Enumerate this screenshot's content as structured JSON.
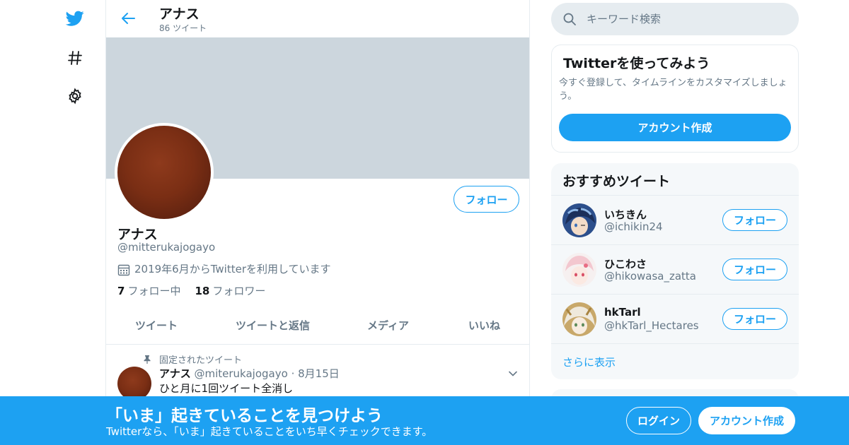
{
  "colors": {
    "accent": "#1da1f2",
    "banner": "#ccd6dd",
    "muted": "#657786",
    "text": "#14171a"
  },
  "nav": {
    "icons": [
      "twitter-bird-icon",
      "hashtag-icon",
      "gear-icon"
    ]
  },
  "header": {
    "title": "アナス",
    "tweet_count": "86 ツイート"
  },
  "profile": {
    "follow_label": "フォロー",
    "name": "アナス",
    "handle": "@mitterukajogayo",
    "joined": "2019年6月からTwitterを利用しています",
    "following_count": "7",
    "following_label": "フォロー中",
    "followers_count": "18",
    "followers_label": "フォロワー"
  },
  "tabs": [
    "ツイート",
    "ツイートと返信",
    "メディア",
    "いいね"
  ],
  "pinned_tweet": {
    "pinned_label": "固定されたツイート",
    "author": "アナス",
    "handle": "@miterukajogayo",
    "date": "8月15日",
    "text": "ひと月に1回ツイート全消し"
  },
  "search": {
    "placeholder": "キーワード検索"
  },
  "signup_card": {
    "title": "Twitterを使ってみよう",
    "description": "今すぐ登録して、タイムラインをカスタマイズしましょう。",
    "button": "アカウント作成"
  },
  "recommended": {
    "title": "おすすめツイート",
    "users": [
      {
        "name": "いちきん",
        "handle": "@ichikin24",
        "follow": "フォロー"
      },
      {
        "name": "ひこわさ",
        "handle": "@hikowasa_zatta",
        "follow": "フォロー"
      },
      {
        "name": "hkTarl",
        "handle": "@hkTarl_Hectares",
        "follow": "フォロー"
      }
    ],
    "more": "さらに表示"
  },
  "bottom_bar": {
    "title": "「いま」起きていることを見つけよう",
    "subtitle": "Twitterなら、「いま」起きていることをいち早くチェックできます。",
    "login": "ログイン",
    "signup": "アカウント作成"
  }
}
